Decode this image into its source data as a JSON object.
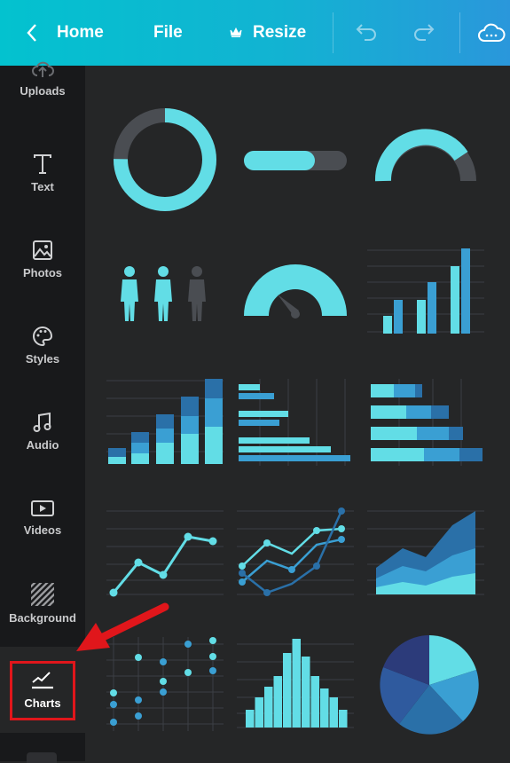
{
  "header": {
    "back_label": "Home",
    "file_label": "File",
    "resize_label": "Resize",
    "icons": [
      "chevron-left-icon",
      "crown-icon",
      "undo-icon",
      "redo-icon",
      "cloud-icon"
    ]
  },
  "sidebar": {
    "items": [
      {
        "label": "Uploads",
        "icon": "upload-icon"
      },
      {
        "label": "Text",
        "icon": "text-icon"
      },
      {
        "label": "Photos",
        "icon": "photo-icon"
      },
      {
        "label": "Styles",
        "icon": "palette-icon"
      },
      {
        "label": "Audio",
        "icon": "music-icon"
      },
      {
        "label": "Videos",
        "icon": "video-icon"
      },
      {
        "label": "Background",
        "icon": "stripes-icon"
      },
      {
        "label": "Charts",
        "icon": "chart-line-icon",
        "active": true
      }
    ]
  },
  "charts_panel": {
    "thumbnails": [
      "donut",
      "progress-bar",
      "half-gauge",
      "people-icons",
      "speedometer",
      "bar-chart",
      "stacked-column",
      "horizontal-bar",
      "stacked-bar",
      "line",
      "multi-line",
      "area",
      "dot-plot",
      "histogram",
      "pie"
    ]
  },
  "colors": {
    "header_start": "#03c2cf",
    "header_end": "#2a97db",
    "cyan": "#62dde6",
    "blue": "#3a9fd3",
    "dark_blue": "#2a70a8",
    "navy": "#2c3b7a",
    "gray": "#4a4d52",
    "annotation": "#e0161b"
  }
}
